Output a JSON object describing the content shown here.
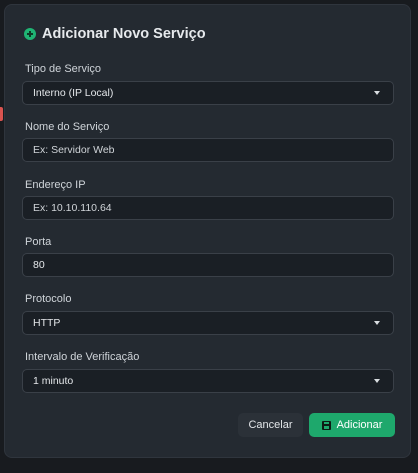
{
  "modal": {
    "title": "Adicionar Novo Serviço",
    "title_icon": "plus-circle-icon",
    "accent_color": "#1ea86c"
  },
  "form": {
    "service_type": {
      "label": "Tipo de Serviço",
      "selected": "Interno (IP Local)"
    },
    "service_name": {
      "label": "Nome do Serviço",
      "placeholder": "Ex: Servidor Web",
      "value": ""
    },
    "ip_address": {
      "label": "Endereço IP",
      "placeholder": "Ex: 10.10.110.64",
      "value": ""
    },
    "port": {
      "label": "Porta",
      "value": "80"
    },
    "protocol": {
      "label": "Protocolo",
      "selected": "HTTP"
    },
    "check_interval": {
      "label": "Intervalo de Verificação",
      "selected": "1 minuto"
    }
  },
  "actions": {
    "cancel_label": "Cancelar",
    "add_label": "Adicionar",
    "add_icon": "save-icon"
  }
}
